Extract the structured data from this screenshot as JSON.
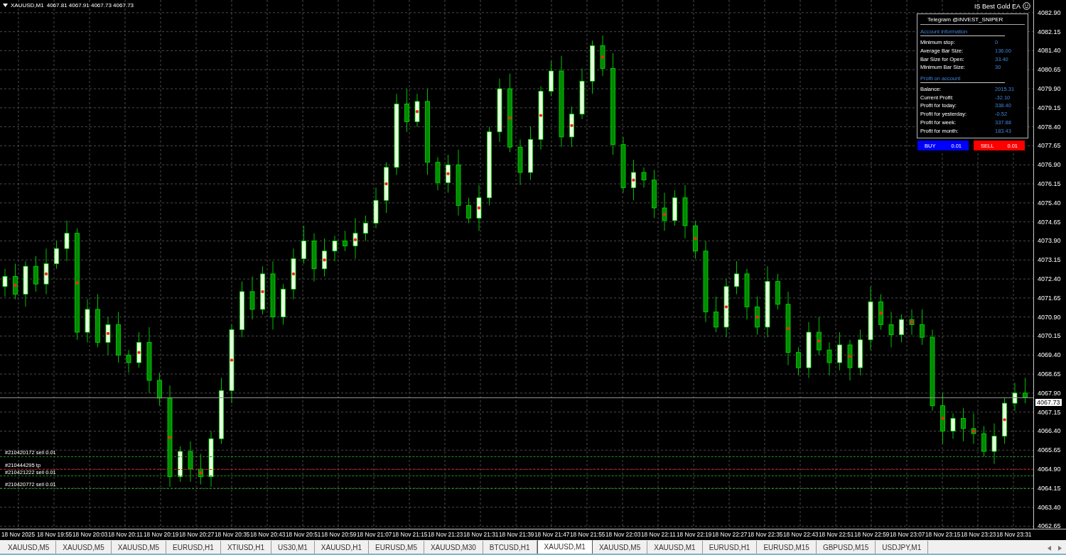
{
  "chart_header": {
    "symbol": "XAUUSD,M1",
    "ohlc": "4067.81 4067.91 4067.73 4067.73"
  },
  "ea_name": "IS Best Gold EA",
  "panel": {
    "header": "Telegram @INVEST_SNIPER",
    "sections": [
      {
        "title": "Account information",
        "rows": [
          {
            "label": "Minimum stop:",
            "value": "0"
          },
          {
            "label": "Average Bar Size:",
            "value": "136.00"
          },
          {
            "label": "Bar Size for Open:",
            "value": "33.40"
          },
          {
            "label": "Minimum Bar Size:",
            "value": "30"
          }
        ]
      },
      {
        "title": "Profit on account",
        "rows": [
          {
            "label": "Balance:",
            "value": "2015.31"
          },
          {
            "label": "Current Profit:",
            "value": "-32.10"
          },
          {
            "label": "Profit for today:",
            "value": "338.40"
          },
          {
            "label": "Profit for yesterday:",
            "value": "-0.52"
          },
          {
            "label": "Profit for week:",
            "value": "337.88"
          },
          {
            "label": "Profit for month:",
            "value": "183.43"
          }
        ]
      }
    ]
  },
  "trade_buttons": [
    {
      "kind": "buy",
      "label": "BUY",
      "lot": "0.01"
    },
    {
      "kind": "sell",
      "label": "SELL",
      "lot": "0.01"
    }
  ],
  "time_axis": [
    "18 Nov 2025",
    "18 Nov 19:55",
    "18 Nov 20:03",
    "18 Nov 20:11",
    "18 Nov 20:19",
    "18 Nov 20:27",
    "18 Nov 20:35",
    "18 Nov 20:43",
    "18 Nov 20:51",
    "18 Nov 20:59",
    "18 Nov 21:07",
    "18 Nov 21:15",
    "18 Nov 21:23",
    "18 Nov 21:31",
    "18 Nov 21:39",
    "18 Nov 21:47",
    "18 Nov 21:55",
    "18 Nov 22:03",
    "18 Nov 22:11",
    "18 Nov 22:19",
    "18 Nov 22:27",
    "18 Nov 22:35",
    "18 Nov 22:43",
    "18 Nov 22:51",
    "18 Nov 22:59",
    "18 Nov 23:07",
    "18 Nov 23:15",
    "18 Nov 23:23",
    "18 Nov 23:31"
  ],
  "chart_data": {
    "type": "candlestick",
    "categories": [
      null,
      null,
      null,
      null,
      null,
      null,
      null,
      null,
      null,
      null,
      null,
      null,
      null,
      null,
      null,
      null,
      null,
      null,
      null,
      null,
      null,
      null,
      null,
      null,
      null,
      null,
      null,
      null,
      null,
      null,
      null,
      null,
      null,
      null,
      null,
      null,
      null,
      null,
      null,
      null,
      null,
      null,
      null,
      null,
      null,
      null,
      null,
      null,
      null,
      null,
      null,
      null,
      null,
      null,
      null,
      null,
      null,
      null,
      null,
      null,
      null,
      null,
      null,
      null,
      null,
      null,
      null,
      null,
      null,
      null,
      null,
      null,
      null,
      null,
      null,
      null,
      null,
      null,
      null,
      null,
      null,
      null,
      null,
      null,
      null,
      null,
      null,
      null,
      null,
      null,
      null,
      null,
      null,
      null,
      null,
      null,
      null,
      null,
      null,
      null
    ],
    "ylim": [
      4062.55,
      4083.4
    ],
    "grid": true,
    "yticks": [
      {
        "value": 4082.9,
        "label": "4082.90"
      },
      {
        "value": 4082.15,
        "label": "4082.15"
      },
      {
        "value": 4081.4,
        "label": "4081.40"
      },
      {
        "value": 4080.65,
        "label": "4080.65"
      },
      {
        "value": 4079.9,
        "label": "4079.90"
      },
      {
        "value": 4079.15,
        "label": "4079.15"
      },
      {
        "value": 4078.4,
        "label": "4078.40"
      },
      {
        "value": 4077.65,
        "label": "4077.65"
      },
      {
        "value": 4076.9,
        "label": "4076.90"
      },
      {
        "value": 4076.15,
        "label": "4076.15"
      },
      {
        "value": 4075.4,
        "label": "4075.40"
      },
      {
        "value": 4074.65,
        "label": "4074.65"
      },
      {
        "value": 4073.9,
        "label": "4073.90"
      },
      {
        "value": 4073.15,
        "label": "4073.15"
      },
      {
        "value": 4072.4,
        "label": "4072.40"
      },
      {
        "value": 4071.65,
        "label": "4071.65"
      },
      {
        "value": 4070.9,
        "label": "4070.90"
      },
      {
        "value": 4070.15,
        "label": "4070.15"
      },
      {
        "value": 4069.4,
        "label": "4069.40"
      },
      {
        "value": 4068.65,
        "label": "4068.65"
      },
      {
        "value": 4067.9,
        "label": "4067.90"
      },
      {
        "value": 4067.15,
        "label": "4067.15"
      },
      {
        "value": 4066.4,
        "label": "4066.40"
      },
      {
        "value": 4065.65,
        "label": "4065.65"
      },
      {
        "value": 4064.9,
        "label": "4064.90"
      },
      {
        "value": 4064.15,
        "label": "4064.15"
      },
      {
        "value": 4063.4,
        "label": "4063.40"
      },
      {
        "value": 4062.65,
        "label": "4062.65"
      }
    ],
    "ohlc": [
      [
        4072.1,
        4072.8,
        4071.7,
        4072.5
      ],
      [
        4072.5,
        4073.0,
        4071.6,
        4071.8
      ],
      [
        4071.8,
        4073.1,
        4071.3,
        4072.9
      ],
      [
        4072.9,
        4073.3,
        4071.9,
        4072.2
      ],
      [
        4072.2,
        4073.6,
        4071.8,
        4073.0
      ],
      [
        4073.0,
        4073.9,
        4072.8,
        4073.6
      ],
      [
        4073.6,
        4074.7,
        4073.1,
        4074.2
      ],
      [
        4074.2,
        4074.4,
        4070.0,
        4070.3
      ],
      [
        4070.3,
        4071.6,
        4069.9,
        4071.2
      ],
      [
        4071.2,
        4071.8,
        4069.7,
        4069.9
      ],
      [
        4069.9,
        4070.9,
        4069.4,
        4070.6
      ],
      [
        4070.6,
        4071.1,
        4069.1,
        4069.4
      ],
      [
        4069.4,
        4069.6,
        4068.7,
        4069.1
      ],
      [
        4069.1,
        4070.3,
        4068.9,
        4069.9
      ],
      [
        4069.9,
        4070.5,
        4067.9,
        4068.4
      ],
      [
        4068.4,
        4068.7,
        4067.4,
        4067.7
      ],
      [
        4067.7,
        4068.2,
        4064.2,
        4064.6
      ],
      [
        4064.6,
        4065.8,
        4064.4,
        4065.6
      ],
      [
        4065.6,
        4066.0,
        4064.4,
        4064.9
      ],
      [
        4064.9,
        4065.5,
        4064.3,
        4064.6
      ],
      [
        4064.6,
        4066.4,
        4064.2,
        4066.1
      ],
      [
        4066.1,
        4068.5,
        4065.9,
        4068.0
      ],
      [
        4068.0,
        4070.6,
        4067.5,
        4070.4
      ],
      [
        4070.4,
        4072.3,
        4070.1,
        4071.9
      ],
      [
        4071.9,
        4072.5,
        4070.8,
        4071.2
      ],
      [
        4071.2,
        4072.9,
        4071.0,
        4072.6
      ],
      [
        4072.6,
        4073.1,
        4070.4,
        4070.9
      ],
      [
        4070.9,
        4072.2,
        4070.6,
        4072.0
      ],
      [
        4072.0,
        4073.6,
        4071.6,
        4073.2
      ],
      [
        4073.2,
        4074.5,
        4073.0,
        4073.9
      ],
      [
        4073.9,
        4074.2,
        4072.3,
        4072.8
      ],
      [
        4072.8,
        4074.0,
        4072.5,
        4073.5
      ],
      [
        4073.5,
        4074.1,
        4073.1,
        4073.9
      ],
      [
        4073.9,
        4074.3,
        4073.5,
        4073.7
      ],
      [
        4073.7,
        4074.8,
        4073.2,
        4074.2
      ],
      [
        4074.2,
        4074.9,
        4073.9,
        4074.6
      ],
      [
        4074.6,
        4076.0,
        4074.4,
        4075.5
      ],
      [
        4075.5,
        4077.0,
        4075.0,
        4076.8
      ],
      [
        4076.8,
        4079.7,
        4076.5,
        4079.3
      ],
      [
        4079.3,
        4079.9,
        4078.2,
        4078.6
      ],
      [
        4078.6,
        4079.7,
        4078.4,
        4079.4
      ],
      [
        4079.4,
        4079.9,
        4076.5,
        4077.0
      ],
      [
        4077.0,
        4077.2,
        4075.9,
        4076.2
      ],
      [
        4076.2,
        4077.3,
        4075.8,
        4076.9
      ],
      [
        4076.9,
        4077.5,
        4074.9,
        4075.3
      ],
      [
        4075.3,
        4075.6,
        4074.6,
        4074.8
      ],
      [
        4074.8,
        4076.1,
        4074.3,
        4075.6
      ],
      [
        4075.6,
        4078.4,
        4075.3,
        4078.2
      ],
      [
        4078.2,
        4080.3,
        4077.8,
        4079.9
      ],
      [
        4079.9,
        4080.5,
        4077.4,
        4077.6
      ],
      [
        4077.6,
        4077.9,
        4076.1,
        4076.6
      ],
      [
        4076.6,
        4078.4,
        4076.3,
        4077.9
      ],
      [
        4077.9,
        4080.0,
        4077.5,
        4079.8
      ],
      [
        4079.8,
        4081.0,
        4079.6,
        4080.6
      ],
      [
        4080.6,
        4081.2,
        4077.6,
        4078.0
      ],
      [
        4078.0,
        4079.2,
        4077.6,
        4078.9
      ],
      [
        4078.9,
        4080.7,
        4078.7,
        4080.2
      ],
      [
        4080.2,
        4081.8,
        4079.7,
        4081.6
      ],
      [
        4081.6,
        4082.0,
        4080.4,
        4080.7
      ],
      [
        4080.7,
        4081.3,
        4077.3,
        4077.7
      ],
      [
        4077.7,
        4078.0,
        4075.8,
        4076.0
      ],
      [
        4076.0,
        4077.1,
        4075.5,
        4076.6
      ],
      [
        4076.6,
        4076.8,
        4076.0,
        4076.3
      ],
      [
        4076.3,
        4076.7,
        4074.8,
        4075.2
      ],
      [
        4075.2,
        4075.8,
        4074.3,
        4074.7
      ],
      [
        4074.7,
        4075.9,
        4074.5,
        4075.6
      ],
      [
        4075.6,
        4076.1,
        4074.0,
        4074.5
      ],
      [
        4074.5,
        4074.7,
        4073.2,
        4073.5
      ],
      [
        4073.5,
        4073.9,
        4070.7,
        4071.1
      ],
      [
        4071.1,
        4071.7,
        4070.3,
        4070.5
      ],
      [
        4070.5,
        4072.4,
        4070.1,
        4072.1
      ],
      [
        4072.1,
        4073.1,
        4071.8,
        4072.6
      ],
      [
        4072.6,
        4072.8,
        4070.8,
        4071.3
      ],
      [
        4071.3,
        4071.7,
        4070.2,
        4070.5
      ],
      [
        4070.5,
        4072.9,
        4070.1,
        4072.3
      ],
      [
        4072.3,
        4072.6,
        4071.2,
        4071.4
      ],
      [
        4071.4,
        4071.9,
        4069.0,
        4069.5
      ],
      [
        4069.5,
        4069.7,
        4068.6,
        4068.9
      ],
      [
        4068.9,
        4070.7,
        4068.5,
        4070.3
      ],
      [
        4070.3,
        4070.9,
        4069.4,
        4069.6
      ],
      [
        4069.6,
        4069.9,
        4068.6,
        4069.1
      ],
      [
        4069.1,
        4070.3,
        4068.8,
        4069.8
      ],
      [
        4069.8,
        4070.0,
        4068.4,
        4068.9
      ],
      [
        4068.9,
        4070.4,
        4068.6,
        4070.0
      ],
      [
        4070.0,
        4072.1,
        4069.6,
        4071.5
      ],
      [
        4071.5,
        4071.8,
        4070.4,
        4070.6
      ],
      [
        4070.6,
        4071.1,
        4069.7,
        4070.2
      ],
      [
        4070.2,
        4071.0,
        4069.9,
        4070.8
      ],
      [
        4070.8,
        4071.2,
        4070.2,
        4070.6
      ],
      [
        4070.6,
        4071.2,
        4069.8,
        4070.1
      ],
      [
        4070.1,
        4070.4,
        4067.2,
        4067.4
      ],
      [
        4067.4,
        4067.9,
        4065.9,
        4066.4
      ],
      [
        4066.4,
        4067.1,
        4066.1,
        4066.9
      ],
      [
        4066.9,
        4067.3,
        4066.0,
        4066.5
      ],
      [
        4066.5,
        4067.1,
        4065.9,
        4066.3
      ],
      [
        4066.3,
        4066.6,
        4065.4,
        4065.6
      ],
      [
        4065.6,
        4066.7,
        4065.1,
        4066.2
      ],
      [
        4066.2,
        4067.7,
        4065.9,
        4067.5
      ],
      [
        4067.5,
        4068.3,
        4067.2,
        4067.9
      ],
      [
        4067.9,
        4068.5,
        4067.5,
        4067.73
      ]
    ]
  },
  "current_price": "4067.73",
  "orders": [
    {
      "label": "#210420172 sell 0.01",
      "color": "#1f8f1f"
    },
    {
      "label": "#210444295 tp",
      "color": "#d01010"
    },
    {
      "label": "#210421222 sell 0.01",
      "color": "#1f8f1f"
    },
    {
      "label": "#210420772 sell 0.01",
      "color": "#1f8f1f"
    }
  ],
  "tabs": [
    {
      "label": "XAUUSD,M5",
      "selected": false
    },
    {
      "label": "XAUUSD,M5",
      "selected": false
    },
    {
      "label": "XAUUSD,M5",
      "selected": false
    },
    {
      "label": "EURUSD,H1",
      "selected": false
    },
    {
      "label": "XTIUSD,H1",
      "selected": false
    },
    {
      "label": "US30,M1",
      "selected": false
    },
    {
      "label": "XAUUSD,H1",
      "selected": false
    },
    {
      "label": "EURUSD,M5",
      "selected": false
    },
    {
      "label": "XAUUSD,M30",
      "selected": false
    },
    {
      "label": "BTCUSD,H1",
      "selected": false
    },
    {
      "label": "XAUUSD,M1",
      "selected": true
    },
    {
      "label": "XAUUSD,M5",
      "selected": false
    },
    {
      "label": "XAUUSD,M1",
      "selected": false
    },
    {
      "label": "EURUSD,H1",
      "selected": false
    },
    {
      "label": "EURUSD,M15",
      "selected": false
    },
    {
      "label": "GBPUSD,M15",
      "selected": false
    },
    {
      "label": "USDJPY,M1",
      "selected": false
    }
  ]
}
